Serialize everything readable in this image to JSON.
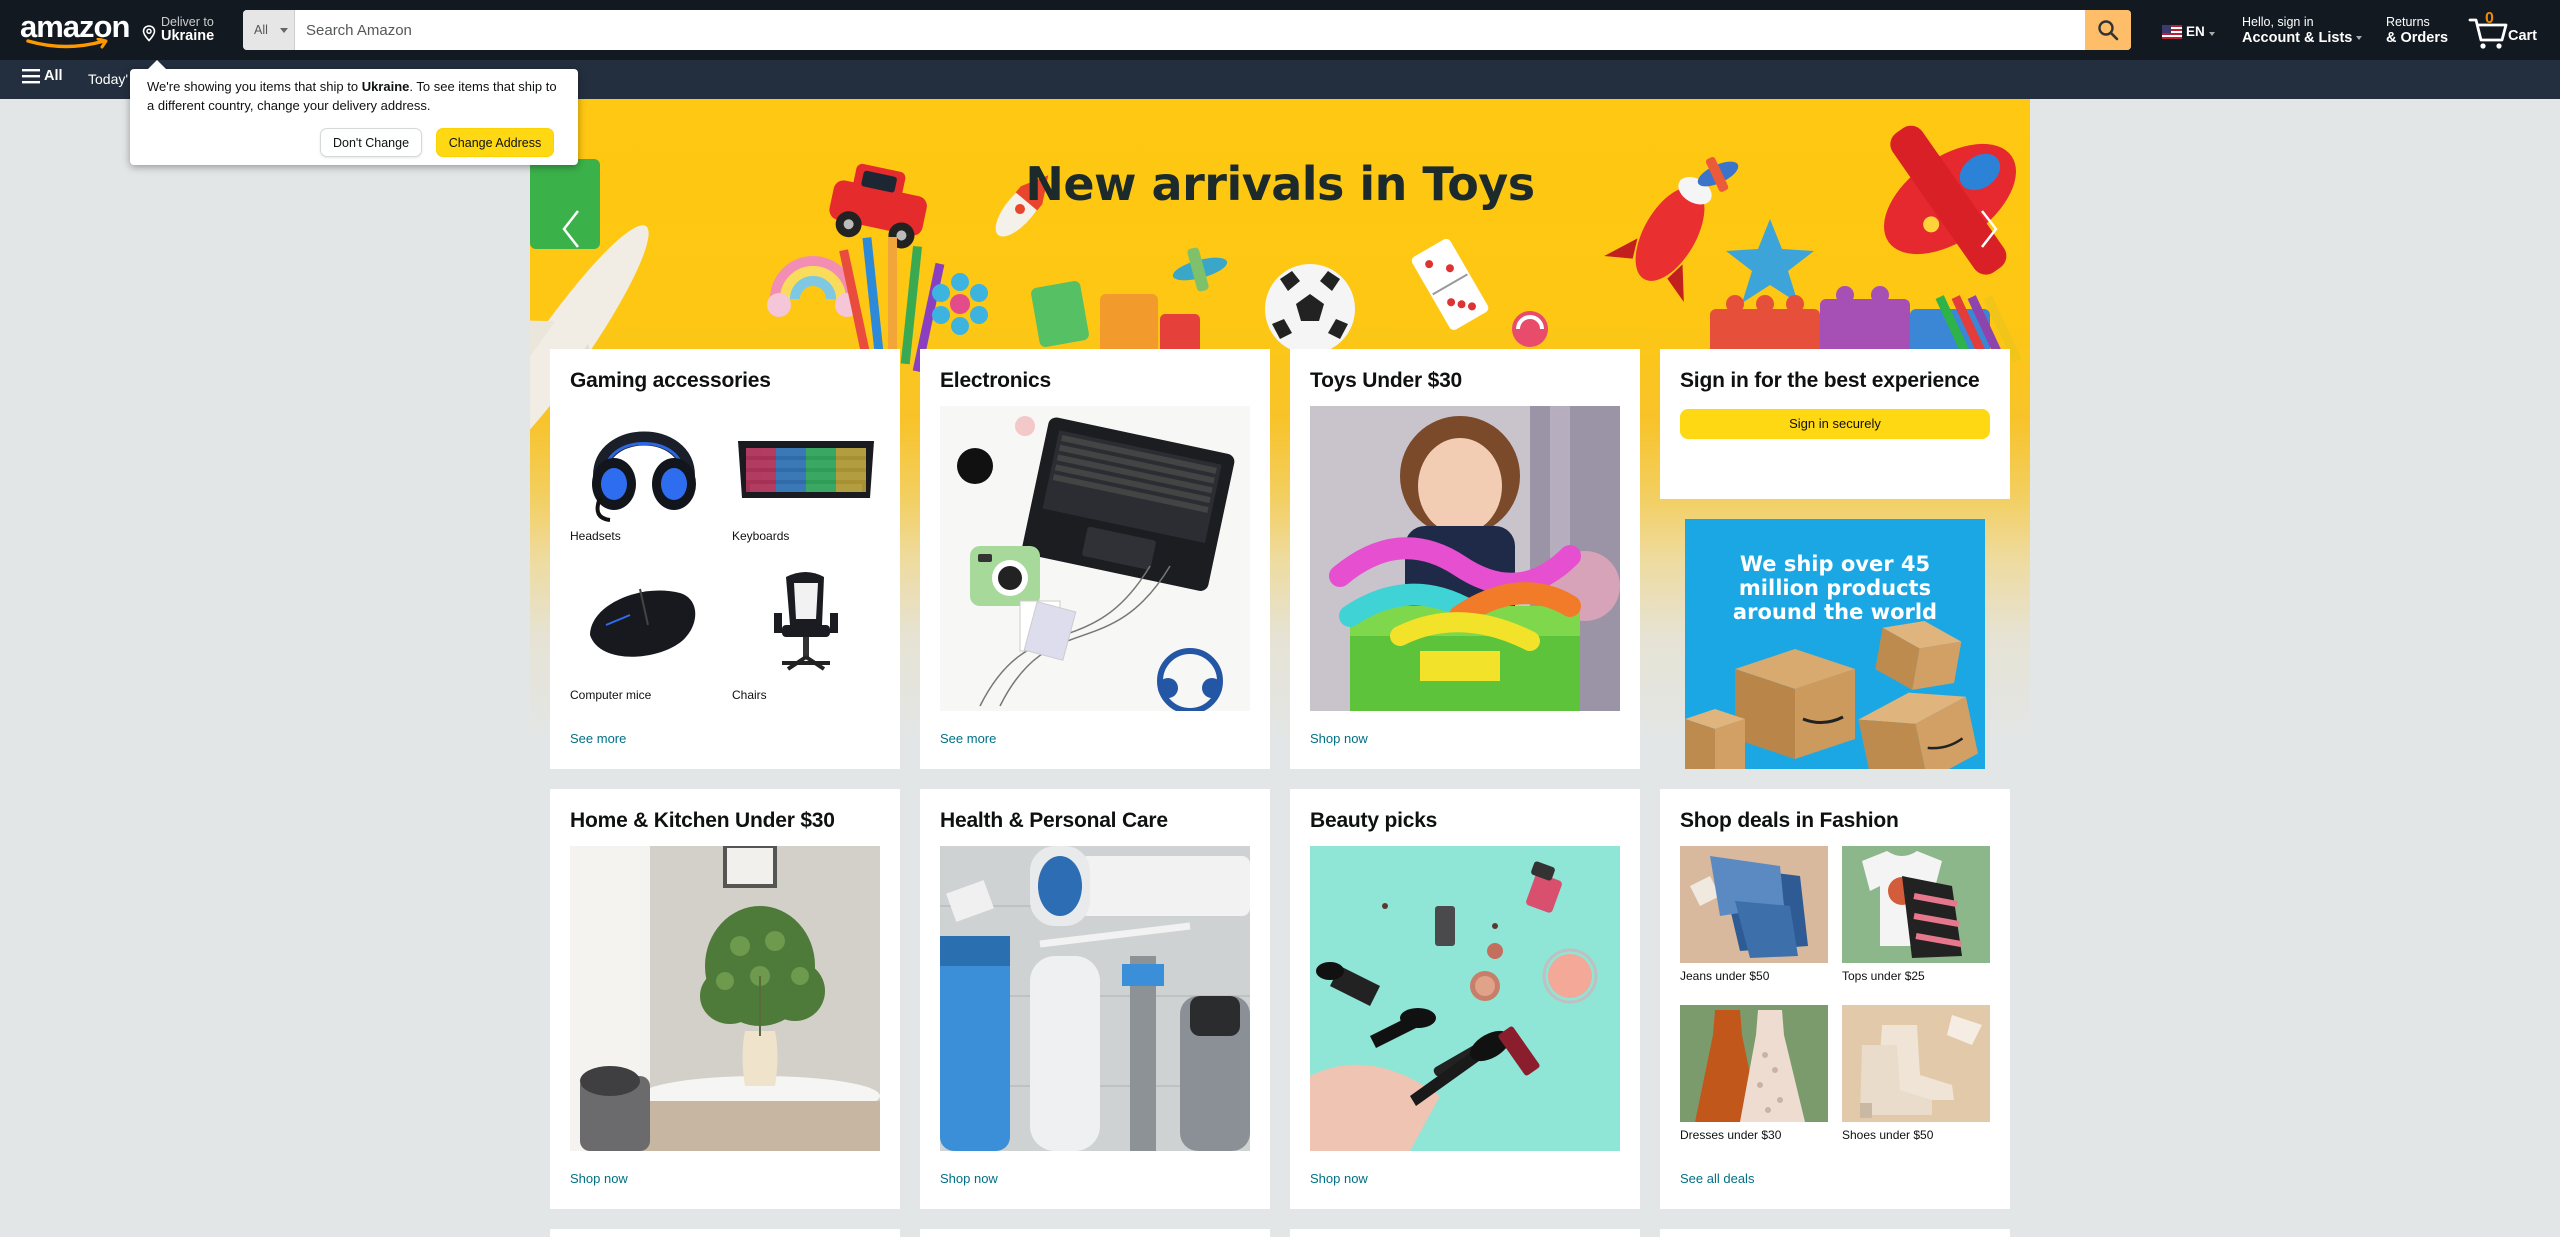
{
  "header": {
    "logo_text": "amazon",
    "deliver": {
      "line1": "Deliver to",
      "line2": "Ukraine"
    },
    "search": {
      "category": "All",
      "placeholder": "Search Amazon"
    },
    "language": "EN",
    "account": {
      "line1": "Hello, sign in",
      "line2": "Account & Lists"
    },
    "returns": {
      "line1": "Returns",
      "line2": "& Orders"
    },
    "cart": {
      "count": "0",
      "label": "Cart"
    }
  },
  "subnav": {
    "all_label": "All",
    "todays_deals_label": "Today's Deals"
  },
  "popover": {
    "text_before": "We're showing you items that ship to ",
    "country": "Ukraine",
    "text_after": ". To see items that ship to a different country, change your delivery address.",
    "dont_change_label": "Don't Change",
    "change_address_label": "Change Address"
  },
  "hero": {
    "title": "New arrivals in Toys"
  },
  "cards": {
    "gaming": {
      "title": "Gaming accessories",
      "items": [
        {
          "label": "Headsets",
          "icon": "headset-image"
        },
        {
          "label": "Keyboards",
          "icon": "keyboard-image"
        },
        {
          "label": "Computer mice",
          "icon": "mouse-image"
        },
        {
          "label": "Chairs",
          "icon": "chair-image"
        }
      ],
      "link": "See more"
    },
    "electronics": {
      "title": "Electronics",
      "link": "See more"
    },
    "toys": {
      "title": "Toys Under $30",
      "link": "Shop now"
    },
    "signin": {
      "title": "Sign in for the best experience",
      "button": "Sign in securely"
    },
    "ship_ad": {
      "text": "We ship over 45 million products around the world"
    },
    "home": {
      "title": "Home & Kitchen Under $30",
      "link": "Shop now"
    },
    "health": {
      "title": "Health & Personal Care",
      "link": "Shop now"
    },
    "beauty": {
      "title": "Beauty picks",
      "link": "Shop now"
    },
    "fashion": {
      "title": "Shop deals in Fashion",
      "items": [
        {
          "label": "Jeans under $50",
          "icon": "jeans-image"
        },
        {
          "label": "Tops under $25",
          "icon": "tops-image"
        },
        {
          "label": "Dresses under $30",
          "icon": "dresses-image"
        },
        {
          "label": "Shoes under $50",
          "icon": "shoes-image"
        }
      ],
      "link": "See all deals"
    }
  },
  "colors": {
    "nav_belt": "#131921",
    "nav_main": "#232f3e",
    "search_button": "#febd69",
    "primary_button": "#ffd814",
    "link": "#007185",
    "hero_yellow": "#ffc812",
    "page_bg": "#e3e6e6",
    "ship_ad_bg": "#1ba7e4"
  }
}
